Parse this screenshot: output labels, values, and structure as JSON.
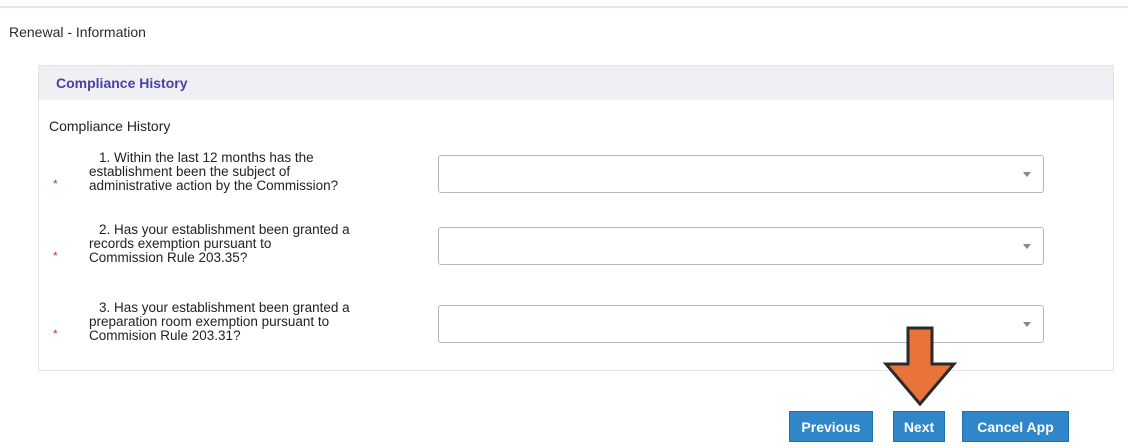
{
  "page": {
    "heading": "Renewal - Information"
  },
  "panel": {
    "title": "Compliance History",
    "section_label": "Compliance History",
    "required_marker": "*",
    "questions": [
      {
        "line1": "1. Within the last 12 months has the",
        "line2": "establishment been the subject of",
        "line3": "administrative action by the Commission?",
        "selected_value": ""
      },
      {
        "line1": "2. Has your establishment been granted a",
        "line2": "records exemption pursuant to",
        "line3": "Commission Rule 203.35?",
        "selected_value": ""
      },
      {
        "line1": "3. Has your establishment been granted a",
        "line2": "preparation room exemption pursuant to",
        "line3": "Commision Rule 203.31?",
        "selected_value": ""
      }
    ]
  },
  "buttons": {
    "previous_label": "Previous",
    "next_label": "Next",
    "cancel_label": "Cancel App"
  },
  "colors": {
    "button_bg": "#2f86c9",
    "panel_title": "#4a3fa8",
    "required": "#cc3333",
    "annotation_arrow": "#e8743b"
  }
}
